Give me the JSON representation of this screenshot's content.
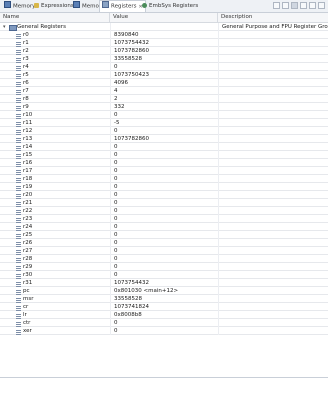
{
  "tabs": [
    {
      "label": "Memory",
      "icon": "memory-icon",
      "active": false
    },
    {
      "label": "Expressions",
      "icon": "expressions-icon",
      "active": false
    },
    {
      "label": "Memory",
      "icon": "memory-icon",
      "active": false
    },
    {
      "label": "Registers",
      "icon": "registers-icon",
      "active": true,
      "close": "✕"
    },
    {
      "label": "EmbSys Registers",
      "icon": "embsys-icon",
      "active": false
    }
  ],
  "columns": {
    "name": "Name",
    "value": "Value",
    "description": "Description"
  },
  "group": {
    "twisty": "▾",
    "label": "General Registers",
    "description": "General Purpose and FPU Register Group"
  },
  "registers": [
    {
      "name": "r0",
      "value": "8390840"
    },
    {
      "name": "r1",
      "value": "1073754432"
    },
    {
      "name": "r2",
      "value": "1073782860"
    },
    {
      "name": "r3",
      "value": "33558528"
    },
    {
      "name": "r4",
      "value": "0"
    },
    {
      "name": "r5",
      "value": "1073750423"
    },
    {
      "name": "r6",
      "value": "4096"
    },
    {
      "name": "r7",
      "value": "4"
    },
    {
      "name": "r8",
      "value": "2"
    },
    {
      "name": "r9",
      "value": "332"
    },
    {
      "name": "r10",
      "value": "0"
    },
    {
      "name": "r11",
      "value": "-5"
    },
    {
      "name": "r12",
      "value": "0"
    },
    {
      "name": "r13",
      "value": "1073782860"
    },
    {
      "name": "r14",
      "value": "0"
    },
    {
      "name": "r15",
      "value": "0"
    },
    {
      "name": "r16",
      "value": "0"
    },
    {
      "name": "r17",
      "value": "0"
    },
    {
      "name": "r18",
      "value": "0"
    },
    {
      "name": "r19",
      "value": "0"
    },
    {
      "name": "r20",
      "value": "0"
    },
    {
      "name": "r21",
      "value": "0"
    },
    {
      "name": "r22",
      "value": "0"
    },
    {
      "name": "r23",
      "value": "0"
    },
    {
      "name": "r24",
      "value": "0"
    },
    {
      "name": "r25",
      "value": "0"
    },
    {
      "name": "r26",
      "value": "0"
    },
    {
      "name": "r27",
      "value": "0"
    },
    {
      "name": "r28",
      "value": "0"
    },
    {
      "name": "r29",
      "value": "0"
    },
    {
      "name": "r30",
      "value": "0"
    },
    {
      "name": "r31",
      "value": "1073754432"
    },
    {
      "name": "pc",
      "value": "0x801030 <main+12>"
    },
    {
      "name": "msr",
      "value": "33558528"
    },
    {
      "name": "cr",
      "value": "1073741824"
    },
    {
      "name": "lr",
      "value": "0x8008b8"
    },
    {
      "name": "ctr",
      "value": "0"
    },
    {
      "name": "xer",
      "value": "0"
    }
  ]
}
